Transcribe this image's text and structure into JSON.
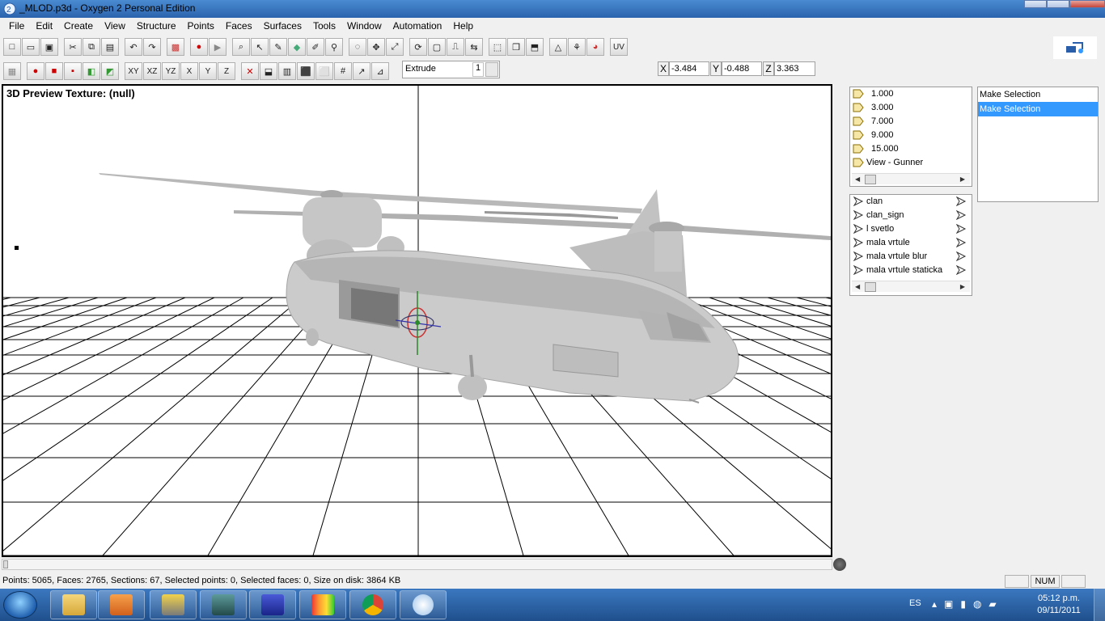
{
  "window": {
    "title": "_MLOD.p3d - Oxygen 2 Personal Edition",
    "app_icon": "oxygen-app-icon"
  },
  "menu": [
    "File",
    "Edit",
    "Create",
    "View",
    "Structure",
    "Points",
    "Faces",
    "Surfaces",
    "Tools",
    "Window",
    "Automation",
    "Help"
  ],
  "toolbar2": {
    "plane_buttons": [
      "XY",
      "XZ",
      "YZ",
      "X",
      "Y",
      "Z"
    ],
    "extrude_label": "Extrude",
    "extrude_value": "1",
    "uv_label": "UV"
  },
  "coords": {
    "x_label": "X",
    "x_value": "-3.484",
    "y_label": "Y",
    "y_value": "-0.488",
    "z_label": "Z",
    "z_value": "3.363"
  },
  "viewport": {
    "title": "3D Preview Texture: (null)"
  },
  "lods": [
    "1.000",
    "3.000",
    "7.000",
    "9.000",
    "15.000",
    "View - Gunner"
  ],
  "selections_panel": [
    {
      "label": "Make Selection",
      "active": false
    },
    {
      "label": "Make Selection",
      "active": true
    }
  ],
  "named_selections": [
    "clan",
    "clan_sign",
    "l svetlo",
    "mala vrtule",
    "mala vrtule blur",
    "mala vrtule staticka"
  ],
  "status": {
    "text": "Points: 5065, Faces: 2765, Sections: 67, Selected points: 0, Selected faces: 0, Size on disk: 3864 KB",
    "num": "NUM"
  },
  "taskbar": {
    "apps": [
      "explorer",
      "media-player",
      "satellite-app",
      "oxygen-o2",
      "grid-app",
      "studio",
      "chrome",
      "oxygen-2"
    ],
    "language": "ES",
    "time": "05:12 p.m.",
    "date": "09/11/2011"
  },
  "colors": {
    "selection_highlight": "#3399ff",
    "taskbar": "#2a5ea0",
    "model": "#c9c9c9"
  }
}
